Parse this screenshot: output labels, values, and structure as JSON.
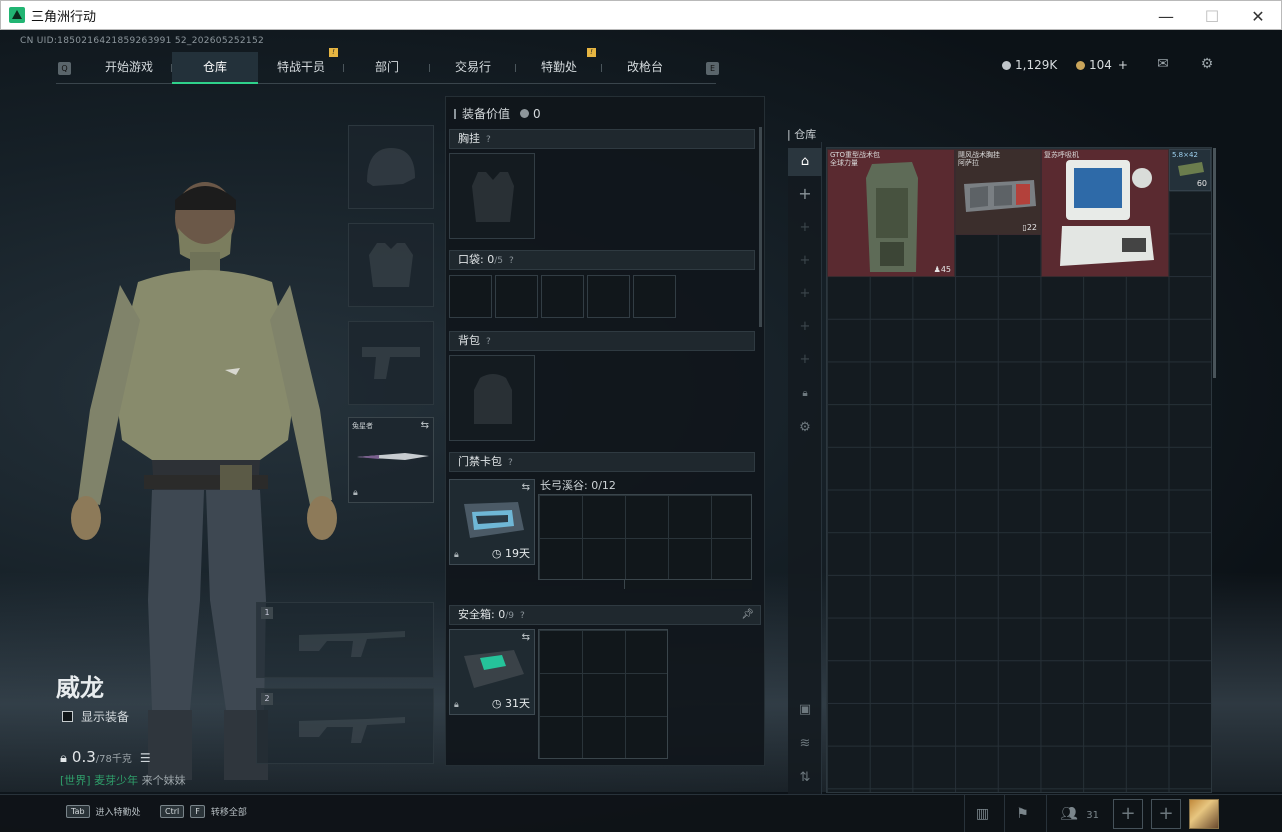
{
  "window": {
    "title": "三角洲行动",
    "minimize": "—",
    "maximize": "☐",
    "close": "✕"
  },
  "uid": "CN UID:1850216421859263991 52_202605252152",
  "nav": {
    "q_key": "Q",
    "e_key": "E",
    "tabs": [
      {
        "label": "开始游戏",
        "active": false,
        "badge": ""
      },
      {
        "label": "仓库",
        "active": true,
        "badge": ""
      },
      {
        "label": "特战干员",
        "active": false,
        "badge": "!"
      },
      {
        "label": "部门",
        "active": false,
        "badge": ""
      },
      {
        "label": "交易行",
        "active": false,
        "badge": ""
      },
      {
        "label": "特勤处",
        "active": false,
        "badge": "!"
      },
      {
        "label": "改枪台",
        "active": false,
        "badge": ""
      }
    ]
  },
  "currency": {
    "silver": "1,129K",
    "gold": "104",
    "add": "+"
  },
  "icons": {
    "mail": "mail-icon",
    "settings": "gear-icon"
  },
  "character": {
    "name": "威龙",
    "show_gear": "显示装备",
    "weight": "0.3",
    "weight_unit": "/78千克",
    "chat_channel": "[世界]",
    "chat_user": "麦芽少年",
    "chat_msg": "来个妹妹"
  },
  "slots": {
    "melee_label": "兔星者"
  },
  "mid": {
    "equip_value_label": "装备价值",
    "equip_value": "0",
    "chest": "胸挂",
    "pocket": "口袋",
    "pocket_count": "0",
    "pocket_total": "/5",
    "backpack": "背包",
    "keycard": "门禁卡包",
    "keycard_map": "长弓溪谷: 0/12",
    "keycard_days": "19天",
    "safebox": "安全箱",
    "safebox_count": "0",
    "safebox_total": "/9",
    "safebox_days": "31天",
    "help": "?"
  },
  "storage": {
    "title": "仓库",
    "items": [
      {
        "label": "GTO重型战术包\n全球力量",
        "count": "45"
      },
      {
        "label": "飓风战术胸挂\n阿萨拉",
        "count": "22"
      },
      {
        "label": "复苏呼吸机",
        "count": ""
      },
      {
        "label": "5.8×42",
        "count": "60"
      }
    ]
  },
  "bottom": {
    "tab_key": "Tab",
    "tab_action": "进入特勤处",
    "ctrlf_key": "Ctrl",
    "f_key": "F",
    "ctrlf_action": "转移全部",
    "friends": "31"
  },
  "colors": {
    "accent": "#2fd18b",
    "badge": "#e6b542",
    "item_red": "#5a2a30",
    "item_dark": "#3b2e2c"
  }
}
